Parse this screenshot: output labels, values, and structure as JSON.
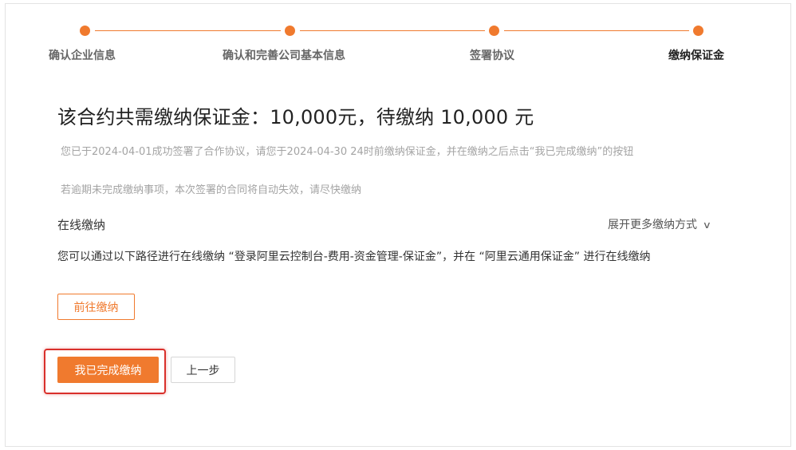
{
  "steps": {
    "items": [
      {
        "label": "确认企业信息"
      },
      {
        "label": "确认和完善公司基本信息"
      },
      {
        "label": "签署协议"
      },
      {
        "label": "缴纳保证金"
      }
    ],
    "accent": "#f07a2e"
  },
  "main": {
    "title": "该合约共需缴纳保证金：10,000元，待缴纳 10,000 元",
    "note_1": "您已于2024-04-01成功签署了合作协议，请您于2024-04-30 24时前缴纳保证金，并在缴纳之后点击“我已完成缴纳”的按钮",
    "note_2": "若逾期未完成缴纳事项，本次签署的合同将自动失效，请尽快缴纳"
  },
  "online": {
    "section_title": "在线缴纳",
    "expand_label": "展开更多缴纳方式",
    "path_text": "您可以通过以下路径进行在线缴纳 “登录阿里云控制台-费用-资金管理-保证金”，并在 “阿里云通用保证金” 进行在线缴纳",
    "goto_button": "前往缴纳"
  },
  "actions": {
    "done_button": "我已完成缴纳",
    "back_button": "上一步"
  },
  "colors": {
    "primary": "#f07a2e",
    "highlight": "#d9302b"
  }
}
